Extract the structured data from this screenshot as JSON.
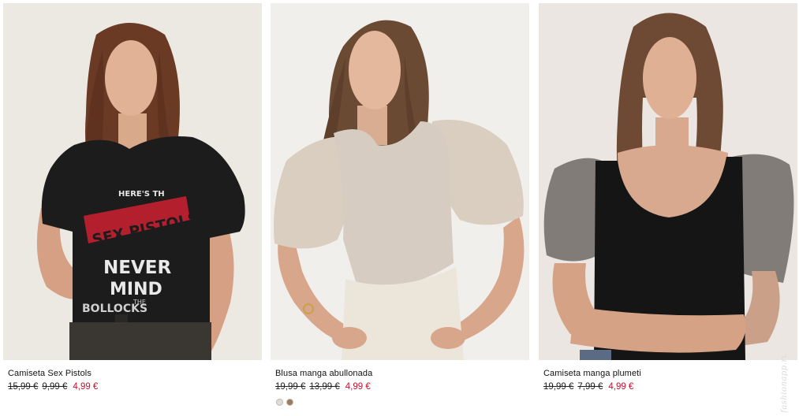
{
  "products": [
    {
      "name": "Camiseta Sex Pistols",
      "old_prices": [
        "15,99 €",
        "9,99 €"
      ],
      "sale_price": "4,99 €",
      "print_lines": [
        "HERE'S TH",
        "SEX PISTOLS",
        "NEVER",
        "MIND",
        "THE",
        "BOLLOCKS"
      ],
      "colors": {
        "background": "#ece8e2",
        "garment": "#1c1c1c"
      }
    },
    {
      "name": "Blusa manga abullonada",
      "old_prices": [
        "19,99 €",
        "13,99 €"
      ],
      "sale_price": "4,99 €",
      "swatches": [
        "#e0dcd6",
        "#9c7a5e"
      ],
      "colors": {
        "background": "#f1efeb",
        "garment": "#d9d0c5"
      }
    },
    {
      "name": "Camiseta manga plumeti",
      "old_prices": [
        "19,99 €",
        "7,99 €"
      ],
      "sale_price": "4,99 €",
      "colors": {
        "background": "#ebe6e1",
        "garment": "#151515"
      }
    }
  ],
  "watermark": "fashionapp.ru",
  "colors": {
    "sale_red": "#c8102e",
    "text": "#111111"
  }
}
